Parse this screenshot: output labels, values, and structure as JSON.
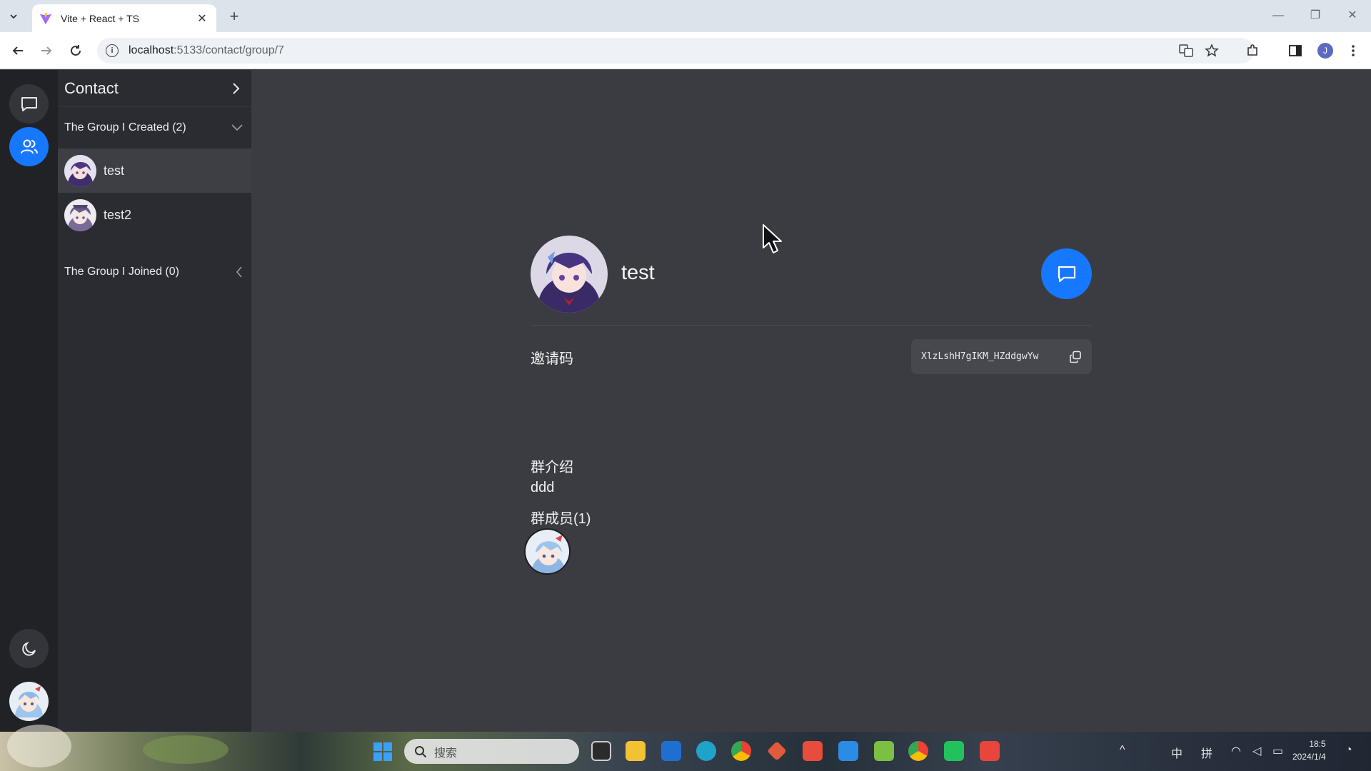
{
  "browser": {
    "tab_title": "Vite + React + TS",
    "url_host": "localhost",
    "url_rest": ":5133/contact/group/7",
    "profile_initial": "J"
  },
  "sidebar": {
    "title": "Contact",
    "created_section": "The Group I Created (2)",
    "created_items": [
      {
        "name": "test"
      },
      {
        "name": "test2"
      }
    ],
    "joined_section": "The Group I Joined (0)"
  },
  "detail": {
    "group_name": "test",
    "invite_label": "邀请码",
    "invite_code": "XlzLshH7gIKM_HZddgwYw",
    "intro_label": "群介绍",
    "intro_text": "ddd",
    "members_label": "群成员(1)"
  },
  "taskbar": {
    "search_label": "搜索",
    "ime_cn": "中",
    "ime_pin": "拼",
    "time": "18:5",
    "date": "2024/1/4"
  },
  "colors": {
    "accent": "#1677ff",
    "rail_bg": "#212226",
    "sidebar_bg": "#2b2c31",
    "main_bg": "#3b3c41"
  }
}
